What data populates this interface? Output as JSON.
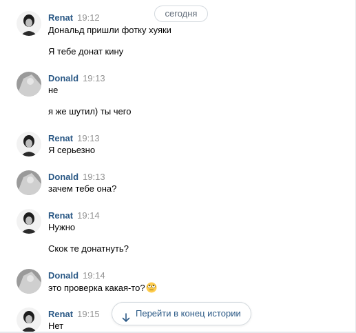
{
  "date_divider": "сегодня",
  "jump_button": {
    "label": "Перейти в конец истории",
    "icon": "arrow-down-icon"
  },
  "messages": [
    {
      "author": "Renat",
      "time": "19:12",
      "lines": [
        "Дональд пришли фотку хуяки",
        "Я тебе донат кину"
      ]
    },
    {
      "author": "Donald",
      "time": "19:13",
      "lines": [
        "не",
        "я же шутил) ты чего"
      ]
    },
    {
      "author": "Renat",
      "time": "19:13",
      "lines": [
        "Я серьезно"
      ]
    },
    {
      "author": "Donald",
      "time": "19:13",
      "lines": [
        "зачем тебе она?"
      ]
    },
    {
      "author": "Renat",
      "time": "19:14",
      "lines": [
        "Нужно",
        "Скок те донатнуть?"
      ]
    },
    {
      "author": "Donald",
      "time": "19:14",
      "lines": [
        "это проверка какая-то?"
      ],
      "emoji": "eye-roll-emoji"
    },
    {
      "author": "Renat",
      "time": "19:15",
      "lines": [
        "Нет"
      ]
    }
  ],
  "colors": {
    "author": "#2a5885",
    "time": "#939393",
    "border": "#d3d9de"
  }
}
